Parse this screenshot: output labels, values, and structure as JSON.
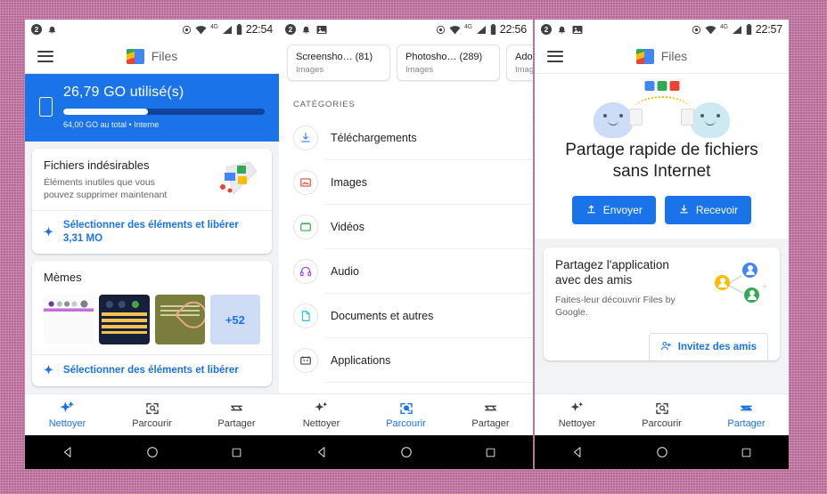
{
  "background": {
    "color": "#c878a8"
  },
  "accent": {
    "blue": "#1a73e8",
    "dark": "#202124",
    "grey": "#5f6368"
  },
  "phones": [
    {
      "id": "phone-clean",
      "statusbar": {
        "time": "22:54",
        "icons": [
          "notification-badge-icon",
          "bell-icon"
        ],
        "right_icons": [
          "location-icon",
          "wifi-icon",
          "4g-icon",
          "signal-icon",
          "battery-icon"
        ],
        "network_label": "4G"
      },
      "appbar": {
        "title": "Files",
        "menu_icon": "hamburger-menu-icon",
        "logo_icon": "files-logo-icon"
      },
      "storage": {
        "used": "26,79  GO utilisé(s)",
        "total": "64,00  GO au total • Interne",
        "percent": 42
      },
      "cards": [
        {
          "title": "Fichiers indésirables",
          "subtitle": "Éléments inutiles que vous pouvez supprimer maintenant",
          "action": "Sélectionner des éléments et libérer 3,31 MO",
          "art": "junk-files-illustration"
        },
        {
          "title": "Mèmes",
          "action": "Sélectionner des éléments et libérer",
          "thumbs": [
            "meme-thumb-1",
            "meme-thumb-2",
            "meme-thumb-3"
          ],
          "overflow": "+52"
        }
      ],
      "bottomnav": [
        {
          "label": "Nettoyer",
          "icon": "sparkle-icon",
          "active": true
        },
        {
          "label": "Parcourir",
          "icon": "browse-search-icon",
          "active": false
        },
        {
          "label": "Partager",
          "icon": "share-arrows-icon",
          "active": false
        }
      ]
    },
    {
      "id": "phone-browse",
      "statusbar": {
        "time": "22:56",
        "icons": [
          "notification-badge-icon",
          "bell-icon",
          "image-icon"
        ],
        "network_label": "4G"
      },
      "chips": [
        {
          "name": "Screensho… (81)",
          "sub": "Images"
        },
        {
          "name": "Photosho… (289)",
          "sub": "Images"
        },
        {
          "name": "Adobe D",
          "sub": "Images"
        }
      ],
      "section_label": "CATÉGORIES",
      "categories": [
        {
          "label": "Téléchargements",
          "icon": "download-icon",
          "color": "#4285f4"
        },
        {
          "label": "Images",
          "icon": "image-icon",
          "color": "#ea4335"
        },
        {
          "label": "Vidéos",
          "icon": "video-icon",
          "color": "#34a853"
        },
        {
          "label": "Audio",
          "icon": "headphones-icon",
          "color": "#a142f4"
        },
        {
          "label": "Documents et autres",
          "icon": "document-icon",
          "color": "#24c1e0"
        },
        {
          "label": "Applications",
          "icon": "apps-icon",
          "color": "#3c4043"
        }
      ],
      "bottomnav": [
        {
          "label": "Nettoyer",
          "icon": "sparkle-icon",
          "active": false
        },
        {
          "label": "Parcourir",
          "icon": "browse-search-icon",
          "active": true
        },
        {
          "label": "Partager",
          "icon": "share-arrows-icon",
          "active": false
        }
      ]
    },
    {
      "id": "phone-share",
      "statusbar": {
        "time": "22:57",
        "icons": [
          "notification-badge-icon",
          "bell-icon",
          "image-icon"
        ],
        "network_label": "4G"
      },
      "appbar": {
        "title": "Files",
        "menu_icon": "hamburger-menu-icon",
        "logo_icon": "files-logo-icon"
      },
      "hero": {
        "heading": "Partage rapide de fichiers sans Internet",
        "illustration": "two-ghosts-sharing-illustration",
        "buttons": [
          {
            "label": "Envoyer",
            "icon": "upload-icon"
          },
          {
            "label": "Recevoir",
            "icon": "download-icon"
          }
        ]
      },
      "promo": {
        "title": "Partagez l'application avec des amis",
        "subtitle": "Faites-leur découvrir Files by Google.",
        "action": "Invitez des amis",
        "action_icon": "person-add-icon",
        "art": "friends-network-illustration"
      },
      "bottomnav": [
        {
          "label": "Nettoyer",
          "icon": "sparkle-icon",
          "active": false
        },
        {
          "label": "Parcourir",
          "icon": "browse-search-icon",
          "active": false
        },
        {
          "label": "Partager",
          "icon": "share-arrows-icon",
          "active": true
        }
      ]
    }
  ],
  "androidnav": {
    "back": "back-triangle-icon",
    "home": "home-circle-icon",
    "recents": "recents-square-icon"
  }
}
